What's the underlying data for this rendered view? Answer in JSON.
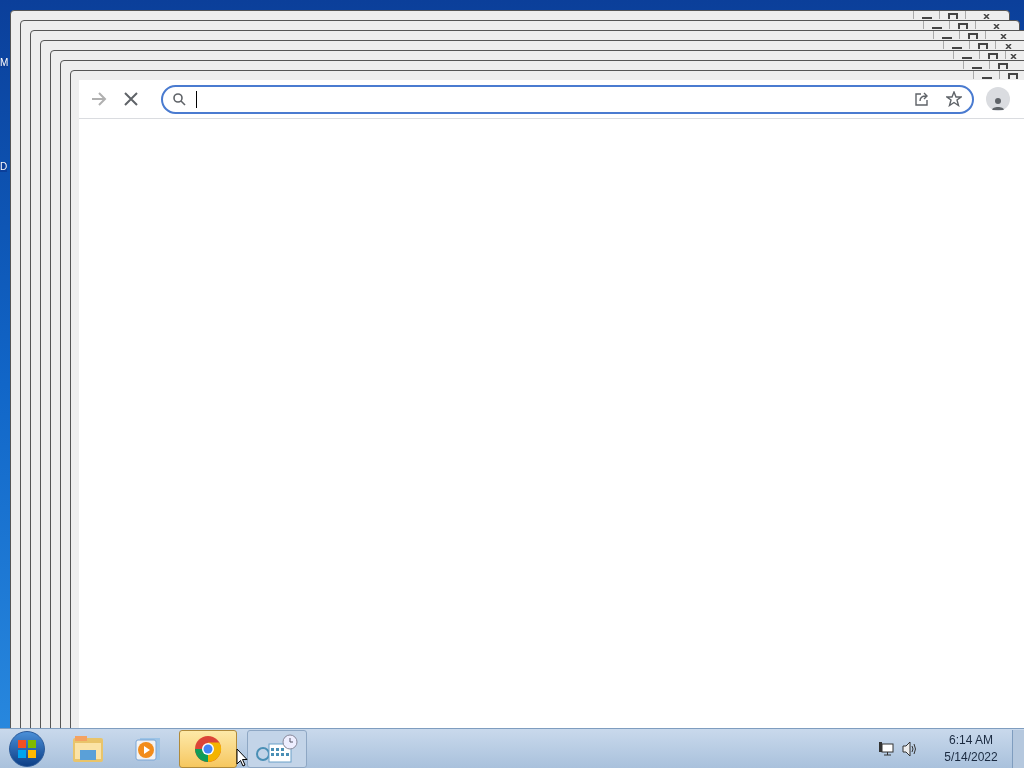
{
  "desktop_icons": [
    {
      "label": "M"
    },
    {
      "label": "D"
    }
  ],
  "background_windows": [
    {
      "kind": "frame"
    },
    {
      "kind": "frame"
    },
    {
      "kind": "frame"
    },
    {
      "kind": "frame"
    },
    {
      "kind": "frame"
    },
    {
      "kind": "frame"
    }
  ],
  "browser": {
    "forward_disabled": true,
    "loading": true,
    "omnibox": {
      "focused": true
    }
  },
  "taskbar": {
    "items": [
      {
        "kind": "explorer",
        "selected": false
      },
      {
        "kind": "media",
        "selected": false
      },
      {
        "kind": "chrome",
        "selected": true
      },
      {
        "kind": "calendar",
        "selected": false
      }
    ],
    "clock": {
      "time": "6:14 AM",
      "date": "5/14/2022"
    }
  }
}
